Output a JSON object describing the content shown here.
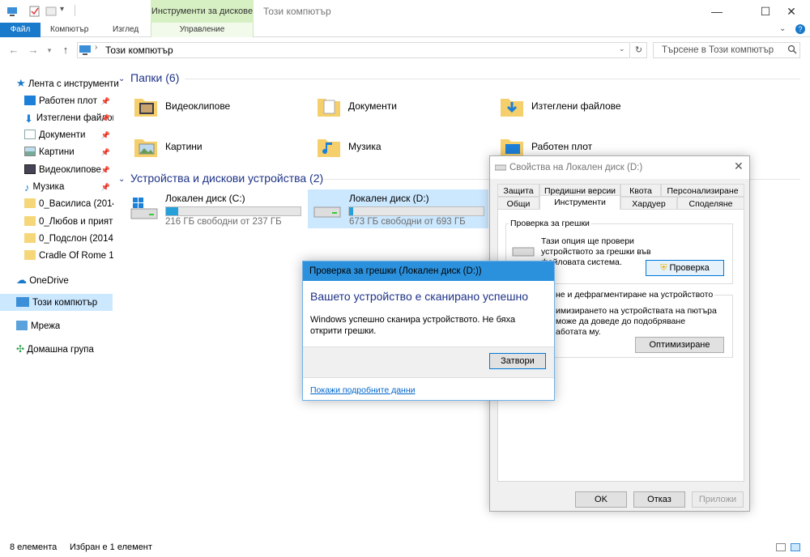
{
  "titlebar": {
    "tools_context_label": "Инструменти за дисковe",
    "window_title": "Този компютър",
    "minimize": "—",
    "maximize": "☐",
    "close": "✕"
  },
  "ribbon": {
    "tabs": [
      "Файл",
      "Компютър",
      "Изглед",
      "Управление"
    ]
  },
  "address": {
    "path": "Този компютър",
    "search_placeholder": "Търсене в Този компютър"
  },
  "sidebar": {
    "quick_access": "Лента с инструменти",
    "pinned": [
      {
        "label": "Работен плот",
        "icon": "desktop-icon"
      },
      {
        "label": "Изтеглени файлове",
        "icon": "download-icon"
      },
      {
        "label": "Документи",
        "icon": "documents-icon"
      },
      {
        "label": "Картини",
        "icon": "pictures-icon"
      },
      {
        "label": "Видеоклипове",
        "icon": "videos-icon"
      },
      {
        "label": "Музика",
        "icon": "music-icon"
      }
    ],
    "folders": [
      "0_Василиса (2014)",
      "0_Любов и прият",
      "0_Подслон (2014)",
      "Cradle Of Rome 1"
    ],
    "onedrive": "OneDrive",
    "this_pc": "Този компютър",
    "network": "Мрежа",
    "homegroup": "Домашна група"
  },
  "content": {
    "folders_header": "Папки (6)",
    "folders": [
      "Видеоклипове",
      "Документи",
      "Изтеглени файлове",
      "Картини",
      "Музика",
      "Работен плот"
    ],
    "devices_header": "Устройства и дискови устройства (2)",
    "drives": [
      {
        "name": "Локален диск (C:)",
        "free": "216 ГБ свободни от 237 ГБ",
        "used_fraction": 0.09
      },
      {
        "name": "Локален диск (D:)",
        "free": "673 ГБ свободни от 693 ГБ",
        "used_fraction": 0.03
      }
    ]
  },
  "status": {
    "count": "8 елемента",
    "selected": "Избран е 1 елемент"
  },
  "properties": {
    "title": "Свойства на Локален диск (D:)",
    "tabs_top": [
      "Защита",
      "Предишни версии",
      "Квота",
      "Персонализиране"
    ],
    "tabs_bottom": [
      "Общи",
      "Инструменти",
      "Хардуер",
      "Споделяне"
    ],
    "check_group_title": "Проверка за грешки",
    "check_text": "Тази опция ще провери устройството за грешки във файловата система.",
    "check_button": "Проверка",
    "optimize_group_title": "не и дефрагментиране на устройството",
    "optimize_text": "имизирането на устройствата на пютъра може да доведе до подобряване аботата му.",
    "optimize_button": "Оптимизиране",
    "ok": "OK",
    "cancel": "Отказ",
    "apply": "Приложи"
  },
  "check_dialog": {
    "title": "Проверка за грешки (Локален диск (D:))",
    "heading": "Вашето устройство е сканирано успешно",
    "message": "Windows успешно сканира устройството. Не бяха открити грешки.",
    "close_button": "Затвори",
    "details_link": "Покажи подробните данни"
  },
  "colors": {
    "accent": "#1979ca",
    "header_blue": "#1e3287",
    "selection": "#cce8ff",
    "dialog_title": "#2b91dd",
    "drive_bar": "#26a0da"
  }
}
